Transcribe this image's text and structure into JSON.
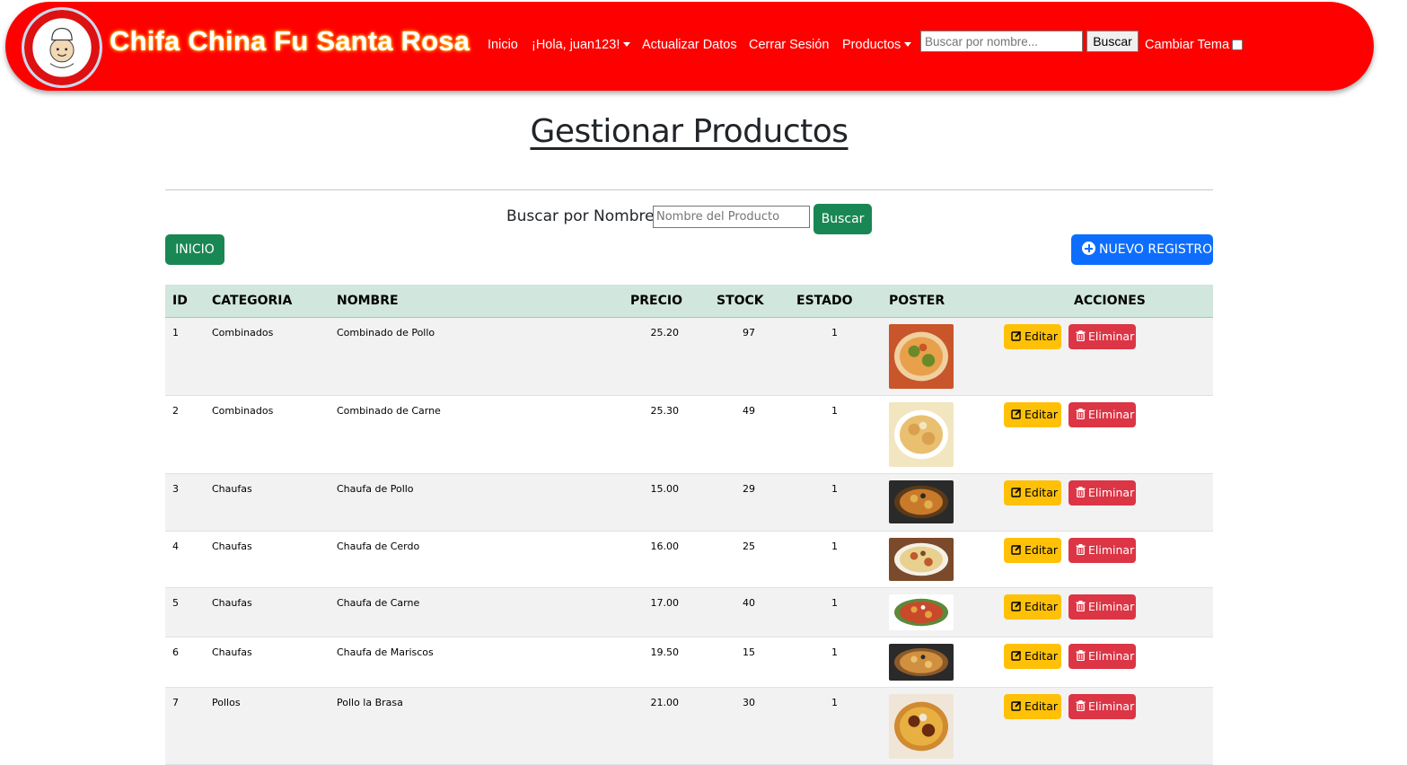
{
  "header": {
    "brand": "Chifa China Fu Santa Rosa",
    "nav": {
      "inicio": "Inicio",
      "greeting": "¡Hola, juan123!",
      "actualizar": "Actualizar Datos",
      "cerrar": "Cerrar Sesión",
      "productos": "Productos"
    },
    "search_placeholder": "Buscar por nombre...",
    "search_button": "Buscar",
    "theme_label": "Cambiar Tema"
  },
  "main": {
    "title": "Gestionar Productos",
    "search_label": "Buscar por Nombre:",
    "search_placeholder": "Nombre del Producto",
    "search_button": "Buscar",
    "inicio_button": "INICIO",
    "nuevo_button": "NUEVO REGISTRO"
  },
  "table": {
    "columns": [
      "ID",
      "CATEGORIA",
      "NOMBRE",
      "PRECIO",
      "STOCK",
      "ESTADO",
      "POSTER",
      "ACCIONES"
    ],
    "edit_label": "Editar",
    "delete_label": "Eliminar",
    "rows": [
      {
        "id": "1",
        "categoria": "Combinados",
        "nombre": "Combinado de Pollo",
        "precio": "25.20",
        "stock": "97",
        "estado": "1"
      },
      {
        "id": "2",
        "categoria": "Combinados",
        "nombre": "Combinado de Carne",
        "precio": "25.30",
        "stock": "49",
        "estado": "1"
      },
      {
        "id": "3",
        "categoria": "Chaufas",
        "nombre": "Chaufa de Pollo",
        "precio": "15.00",
        "stock": "29",
        "estado": "1"
      },
      {
        "id": "4",
        "categoria": "Chaufas",
        "nombre": "Chaufa de Cerdo",
        "precio": "16.00",
        "stock": "25",
        "estado": "1"
      },
      {
        "id": "5",
        "categoria": "Chaufas",
        "nombre": "Chaufa de Carne",
        "precio": "17.00",
        "stock": "40",
        "estado": "1"
      },
      {
        "id": "6",
        "categoria": "Chaufas",
        "nombre": "Chaufa de Mariscos",
        "precio": "19.50",
        "stock": "15",
        "estado": "1"
      },
      {
        "id": "7",
        "categoria": "Pollos",
        "nombre": "Pollo la Brasa",
        "precio": "21.00",
        "stock": "30",
        "estado": "1"
      }
    ]
  },
  "colors": {
    "header_bg": "#ff0000",
    "success": "#198754",
    "primary": "#0d6efd",
    "warning": "#ffc107",
    "danger": "#dc3545",
    "table_head": "#d1e7dd"
  },
  "icons": {
    "edit": "edit-icon",
    "delete": "trash-icon",
    "new": "plus-circle-icon"
  }
}
